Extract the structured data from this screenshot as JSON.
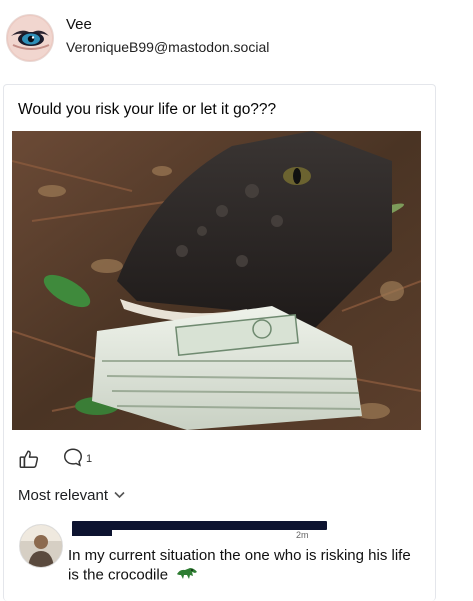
{
  "profile": {
    "display_name": "Vee",
    "handle": "VeroniqueB99@mastodon.social"
  },
  "post": {
    "text": "Would you risk your life or let it go???",
    "image_icon": "crocodile-with-cash-photo"
  },
  "actions": {
    "like_icon": "thumbs-up-icon",
    "comment_icon": "comment-bubble-icon",
    "comment_count": "1"
  },
  "comments_sort": {
    "label": "Most relevant",
    "icon": "chevron-down-icon"
  },
  "comment": {
    "timestamp": "2m",
    "text": "In my current situation the one who is risking his life is the crocodile",
    "emoji_icon": "crocodile-emoji-icon"
  },
  "colors": {
    "accent_dark": "#0d1330",
    "border": "#e4e6eb",
    "croc_emoji": "#2e7d32"
  }
}
